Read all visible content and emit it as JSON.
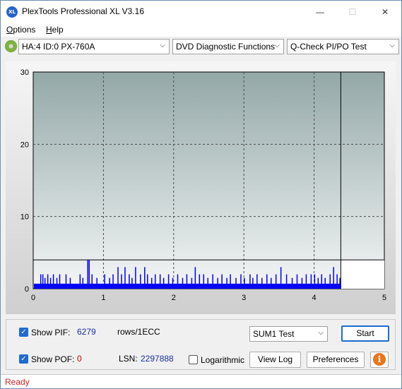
{
  "window": {
    "title": "PlexTools Professional XL V3.16",
    "icon_text": "XL",
    "minimize_glyph": "—",
    "maximize_glyph": "☐",
    "close_glyph": "✕"
  },
  "menu": {
    "items": [
      {
        "label": "Options",
        "underline": "O",
        "rest": "ptions"
      },
      {
        "label": "Help",
        "underline": "H",
        "rest": "elp"
      }
    ]
  },
  "toolbar": {
    "drive": "HA:4 ID:0  PX-760A",
    "function": "DVD Diagnostic Functions",
    "test": "Q-Check PI/PO Test",
    "dropdown_arrow": "⌵"
  },
  "chart_data": {
    "type": "bar",
    "xlim": [
      0,
      5
    ],
    "ylim": [
      0,
      30
    ],
    "x_ticks": [
      "0",
      "1",
      "2",
      "3",
      "4",
      "5"
    ],
    "y_ticks": [
      "0",
      "10",
      "20",
      "30"
    ],
    "grid": true,
    "data_extent_x": 4.38,
    "threshold_y": 4,
    "bar_color": "#0000ff",
    "baseline_value": 0.7,
    "spikes": [
      [
        0.1,
        2
      ],
      [
        0.13,
        2
      ],
      [
        0.16,
        1.5
      ],
      [
        0.2,
        2
      ],
      [
        0.24,
        1.5
      ],
      [
        0.28,
        2
      ],
      [
        0.33,
        1.5
      ],
      [
        0.37,
        2
      ],
      [
        0.46,
        2
      ],
      [
        0.52,
        1.5
      ],
      [
        0.66,
        2
      ],
      [
        0.7,
        1.5
      ],
      [
        0.77,
        4
      ],
      [
        0.79,
        4
      ],
      [
        0.83,
        2
      ],
      [
        0.9,
        1.5
      ],
      [
        1.01,
        2
      ],
      [
        1.08,
        1.5
      ],
      [
        1.13,
        2
      ],
      [
        1.2,
        3
      ],
      [
        1.25,
        2
      ],
      [
        1.3,
        3
      ],
      [
        1.36,
        2
      ],
      [
        1.4,
        1.5
      ],
      [
        1.45,
        3
      ],
      [
        1.52,
        2
      ],
      [
        1.58,
        3
      ],
      [
        1.62,
        2
      ],
      [
        1.68,
        1.5
      ],
      [
        1.73,
        2
      ],
      [
        1.8,
        2
      ],
      [
        1.85,
        1.5
      ],
      [
        1.92,
        2
      ],
      [
        1.98,
        1.5
      ],
      [
        2.05,
        2
      ],
      [
        2.12,
        1.5
      ],
      [
        2.18,
        2
      ],
      [
        2.25,
        1.5
      ],
      [
        2.3,
        3
      ],
      [
        2.36,
        2
      ],
      [
        2.42,
        2
      ],
      [
        2.48,
        1.5
      ],
      [
        2.55,
        2
      ],
      [
        2.62,
        1.5
      ],
      [
        2.68,
        2
      ],
      [
        2.75,
        1.5
      ],
      [
        2.8,
        2
      ],
      [
        2.88,
        1.5
      ],
      [
        2.95,
        2
      ],
      [
        3.0,
        1.5
      ],
      [
        3.08,
        2
      ],
      [
        3.12,
        1.5
      ],
      [
        3.18,
        2
      ],
      [
        3.25,
        1.5
      ],
      [
        3.32,
        2
      ],
      [
        3.38,
        1.5
      ],
      [
        3.45,
        2
      ],
      [
        3.52,
        3
      ],
      [
        3.6,
        2
      ],
      [
        3.68,
        1.5
      ],
      [
        3.75,
        2
      ],
      [
        3.82,
        1.5
      ],
      [
        3.88,
        2
      ],
      [
        3.95,
        2
      ],
      [
        4.0,
        2
      ],
      [
        4.05,
        1.5
      ],
      [
        4.1,
        2
      ],
      [
        4.15,
        1.5
      ],
      [
        4.22,
        2
      ],
      [
        4.27,
        3
      ],
      [
        4.32,
        2
      ],
      [
        4.36,
        1.5
      ]
    ]
  },
  "controls": {
    "show_pif_label": "Show PIF:",
    "show_pif_checked": true,
    "pif_value": "6279",
    "rows_label": "rows/1ECC",
    "show_pof_label": "Show POF:",
    "show_pof_checked": true,
    "pof_value": "0",
    "lsn_label": "LSN:",
    "lsn_value": "2297888",
    "logarithmic_label": "Logarithmic",
    "logarithmic_checked": false,
    "test_select": "SUM1 Test",
    "start_label": "Start",
    "view_log_label": "View Log",
    "preferences_label": "Preferences",
    "info_glyph": "i",
    "check_glyph": "✓"
  },
  "status": {
    "text": "Ready"
  },
  "colors": {
    "pif_value": "#1a2fa0",
    "pof_value": "#cc0000",
    "lsn_value": "#1a2fa0",
    "status_text": "#cc2222",
    "accent": "#1f6bd1"
  }
}
